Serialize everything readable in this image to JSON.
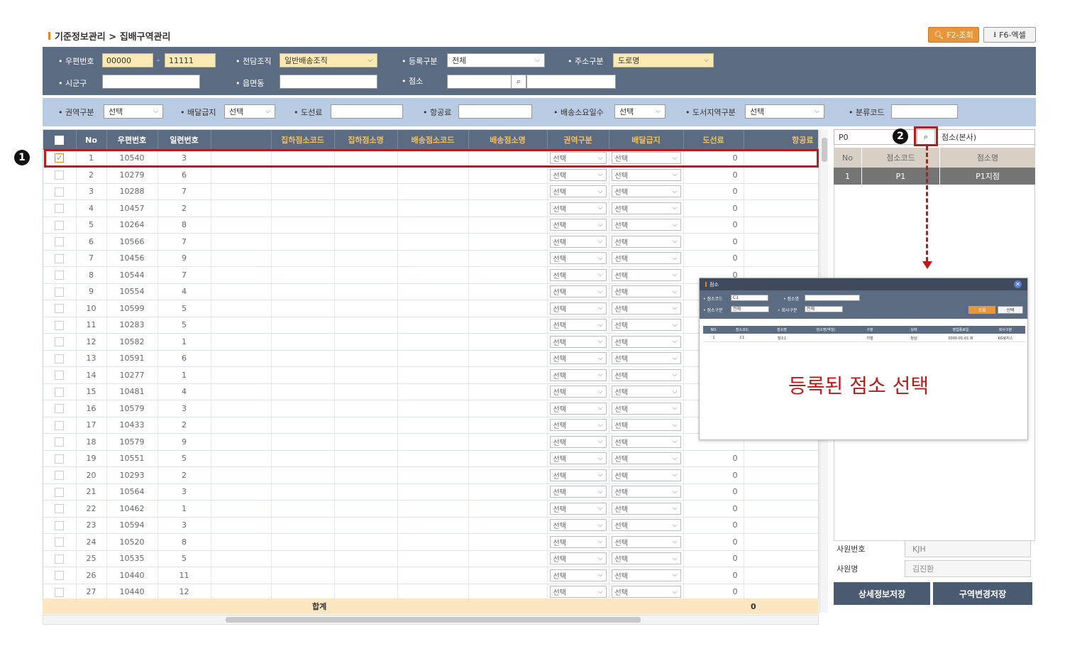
{
  "breadcrumb": "기준정보관리 > 집배구역관리",
  "toolbar": {
    "search_label": "F2-조회",
    "excel_label": "F6-엑셀"
  },
  "filters": {
    "zip_label": "우편번호",
    "zip_from": "00000",
    "zip_to": "11111",
    "org_label": "전담조직",
    "org_value": "일반배송조직",
    "reg_label": "등록구분",
    "reg_value": "전체",
    "addr_label": "주소구분",
    "addr_value": "도로명",
    "sigungu_label": "시군구",
    "eupmyeon_label": "읍면동",
    "branch_label": "점소",
    "region_label": "권역구분",
    "region_value": "선택",
    "delivery_label": "배달급지",
    "delivery_value": "선택",
    "island_label": "도선료",
    "air_label": "항공료",
    "days_label": "배송소요일수",
    "days_value": "선택",
    "islandregion_label": "도서지역구분",
    "islandregion_value": "선택",
    "class_label": "분류코드"
  },
  "grid": {
    "headers": [
      "No",
      "우편번호",
      "일련번호",
      "",
      "집하점소코드",
      "집하점소명",
      "배송점소코드",
      "배송점소명",
      "권역구분",
      "배달급지",
      "도선료",
      "항공료"
    ],
    "select_placeholder": "선택",
    "rows": [
      {
        "no": "1",
        "zip": "10540",
        "seq": "3",
        "fee": "0",
        "checked": true
      },
      {
        "no": "2",
        "zip": "10279",
        "seq": "6",
        "fee": "0"
      },
      {
        "no": "3",
        "zip": "10288",
        "seq": "7",
        "fee": "0"
      },
      {
        "no": "4",
        "zip": "10457",
        "seq": "2",
        "fee": "0"
      },
      {
        "no": "5",
        "zip": "10264",
        "seq": "8",
        "fee": "0"
      },
      {
        "no": "6",
        "zip": "10566",
        "seq": "7",
        "fee": "0"
      },
      {
        "no": "7",
        "zip": "10456",
        "seq": "9",
        "fee": "0"
      },
      {
        "no": "8",
        "zip": "10544",
        "seq": "7",
        "fee": "0"
      },
      {
        "no": "9",
        "zip": "10554",
        "seq": "4",
        "fee": ""
      },
      {
        "no": "10",
        "zip": "10599",
        "seq": "5",
        "fee": ""
      },
      {
        "no": "11",
        "zip": "10283",
        "seq": "5",
        "fee": ""
      },
      {
        "no": "12",
        "zip": "10582",
        "seq": "1",
        "fee": ""
      },
      {
        "no": "13",
        "zip": "10591",
        "seq": "6",
        "fee": ""
      },
      {
        "no": "14",
        "zip": "10277",
        "seq": "1",
        "fee": ""
      },
      {
        "no": "15",
        "zip": "10481",
        "seq": "4",
        "fee": ""
      },
      {
        "no": "16",
        "zip": "10579",
        "seq": "3",
        "fee": ""
      },
      {
        "no": "17",
        "zip": "10433",
        "seq": "2",
        "fee": ""
      },
      {
        "no": "18",
        "zip": "10579",
        "seq": "9",
        "fee": ""
      },
      {
        "no": "19",
        "zip": "10551",
        "seq": "5",
        "fee": "0"
      },
      {
        "no": "20",
        "zip": "10293",
        "seq": "2",
        "fee": "0"
      },
      {
        "no": "21",
        "zip": "10564",
        "seq": "3",
        "fee": "0"
      },
      {
        "no": "22",
        "zip": "10462",
        "seq": "1",
        "fee": "0"
      },
      {
        "no": "23",
        "zip": "10594",
        "seq": "3",
        "fee": "0"
      },
      {
        "no": "24",
        "zip": "10520",
        "seq": "8",
        "fee": "0"
      },
      {
        "no": "25",
        "zip": "10535",
        "seq": "5",
        "fee": "0"
      },
      {
        "no": "26",
        "zip": "10440",
        "seq": "11",
        "fee": "0"
      },
      {
        "no": "27",
        "zip": "10440",
        "seq": "12",
        "fee": "0"
      }
    ],
    "total_label": "합계",
    "total_value": "0"
  },
  "right_panel": {
    "code_value": "P0",
    "name_value": "점소(본사)",
    "headers": [
      "No",
      "점소코드",
      "점소명"
    ],
    "row": {
      "no": "1",
      "code": "P1",
      "name": "P1지점"
    },
    "emp_no_label": "사원번호",
    "emp_no_value": "KJH",
    "emp_name_label": "사원명",
    "emp_name_value": "김진환",
    "save_detail": "상세정보저장",
    "save_area": "구역변경저장"
  },
  "popup": {
    "title": "점소",
    "code_label": "점소코드",
    "code_value": "C1",
    "name_label": "점소명",
    "type_label": "점소구분",
    "type_value": "전체",
    "co_label": "회사구분",
    "co_value": "전체",
    "search_btn": "조회",
    "select_btn": "선택",
    "headers": [
      "NO.",
      "점소코드",
      "점소명",
      "점소명(약칭)",
      "구분",
      "상태",
      "영업종료일",
      "회사구분"
    ],
    "row": [
      "1",
      "C1",
      "점소1",
      "",
      "지점",
      "정상",
      "0000-01-01 화",
      "KG로지스"
    ]
  },
  "annotations": {
    "marker1": "1",
    "marker2": "2",
    "popup_note": "등록된 점소 선택"
  },
  "colors": {
    "header_dark": "#5b6b82",
    "filter_light": "#b9cbe2",
    "marker_red": "#b51c1c",
    "accent_orange": "#e8963c"
  }
}
